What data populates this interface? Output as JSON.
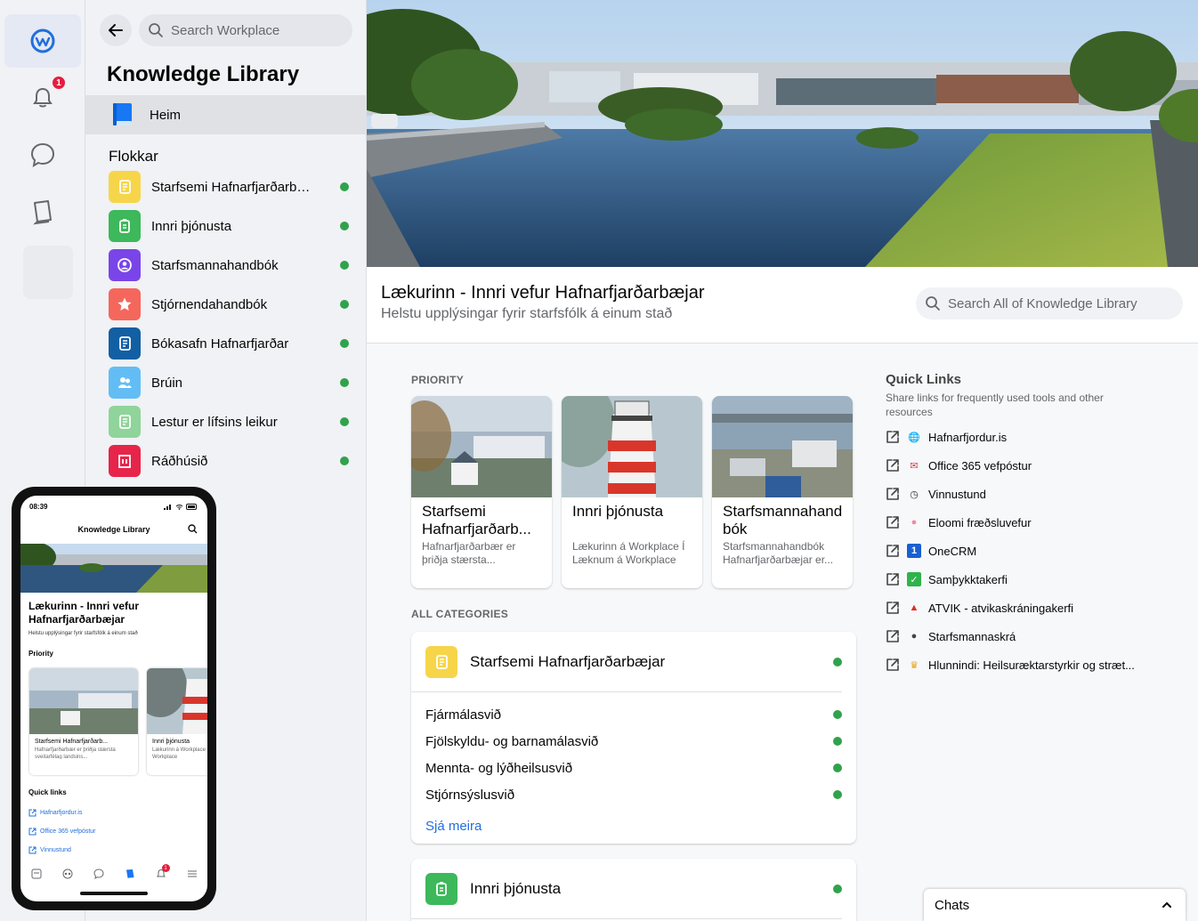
{
  "rail": {
    "items": [
      {
        "name": "workplace-logo-icon"
      },
      {
        "name": "notifications-bell-icon",
        "badge": "1"
      },
      {
        "name": "chat-bubble-icon"
      },
      {
        "name": "knowledge-library-book-icon"
      }
    ]
  },
  "sidebar": {
    "search_placeholder": "Search Workplace",
    "title": "Knowledge Library",
    "home_label": "Heim",
    "categories_heading": "Flokkar",
    "categories": [
      {
        "label": "Starfsemi Hafnarfjarðarbæjar",
        "color": "#f7d54a",
        "icon": "document-icon"
      },
      {
        "label": "Innri þjónusta",
        "color": "#3db85a",
        "icon": "clipboard-icon"
      },
      {
        "label": "Starfsmannahandbók",
        "color": "#7a45e8",
        "icon": "person-icon"
      },
      {
        "label": "Stjórnendahandbók",
        "color": "#f5675c",
        "icon": "star-icon"
      },
      {
        "label": "Bókasafn Hafnarfjarðar",
        "color": "#125fa3",
        "icon": "document-icon"
      },
      {
        "label": "Brúin",
        "color": "#62bdf5",
        "icon": "people-icon"
      },
      {
        "label": "Lestur er lífsins leikur",
        "color": "#8fd49a",
        "icon": "document-icon"
      },
      {
        "label": "Ráðhúsið",
        "color": "#e7244a",
        "icon": "building-icon"
      }
    ]
  },
  "main": {
    "title": "Lækurinn - Innri vefur Hafnarfjarðarbæjar",
    "subtitle": "Helstu upplýsingar fyrir starfsfólk á einum stað",
    "search_placeholder": "Search All of Knowledge Library",
    "priority_label": "PRIORITY",
    "priority_cards": [
      {
        "title": "Starfsemi Hafnarfjarðarb...",
        "desc": "Hafnarfjarðarbær er þriðja stærsta..."
      },
      {
        "title": "Innri þjónusta",
        "desc": "Lækurinn á Workplace Í Læknum á Workplace e..."
      },
      {
        "title": "Starfsmannahand bók",
        "desc": "Starfsmannahandbók Hafnarfjarðarbæjar er..."
      }
    ],
    "all_categories_label": "ALL CATEGORIES",
    "category_cards": [
      {
        "title": "Starfsemi Hafnarfjarðarbæjar",
        "color": "#f7d54a",
        "rows": [
          "Fjármálasvið",
          "Fjölskyldu- og barnamálasvið",
          "Mennta- og lýðheilsusvið",
          "Stjórnsýslusvið"
        ],
        "more": "Sjá meira"
      },
      {
        "title": "Innri þjónusta",
        "color": "#3db85a"
      }
    ],
    "quick_links": {
      "title": "Quick Links",
      "subtitle": "Share links for frequently used tools and other resources",
      "items": [
        {
          "label": "Hafnarfjordur.is",
          "icon": "globe-icon",
          "color": "#1aa0d8"
        },
        {
          "label": "Office 365 vefpóstur",
          "icon": "mail-icon",
          "color": "#e23b3b"
        },
        {
          "label": "Vinnustund",
          "icon": "clock-icon",
          "color": "#333333"
        },
        {
          "label": "Eloomi fræðsluvefur",
          "icon": "brain-icon",
          "color": "#f08aa0"
        },
        {
          "label": "OneCRM",
          "icon": "number-one-icon",
          "color": "#1a5fd1"
        },
        {
          "label": "Samþykktakerfi",
          "icon": "check-icon",
          "color": "#2fb34a"
        },
        {
          "label": "ATVIK - atvikaskráningakerfi",
          "icon": "warning-triangle-icon",
          "color": "#e0301e"
        },
        {
          "label": "Starfsmannaskrá",
          "icon": "people-icon",
          "color": "#444444"
        },
        {
          "label": "Hlunnindi: Heilsuræktarstyrkir og stræt...",
          "icon": "trophy-icon",
          "color": "#e8a317"
        }
      ]
    },
    "chats_label": "Chats"
  },
  "phone": {
    "time": "08:39",
    "title": "Knowledge Library",
    "page_title": "Lækurinn - Innri vefur Hafnarfjarðarbæjar",
    "page_subtitle": "Helstu upplýsingar fyrir starfsfólk á einum stað",
    "priority_label": "Priority",
    "cards": [
      {
        "title": "Starfsemi Hafnarfjarðarb...",
        "desc": "Hafnarfjarðarbær er þriðja stærsta sveitarfélag landsins..."
      },
      {
        "title": "Innri þjónusta",
        "desc": "Lækurinn á Workplace Læknum á Workplace"
      }
    ],
    "quick_links_label": "Quick links",
    "links": [
      "Hafnarfjordur.is",
      "Office 365 vefpóstur",
      "Vinnustund"
    ],
    "tab_badge": "1"
  }
}
